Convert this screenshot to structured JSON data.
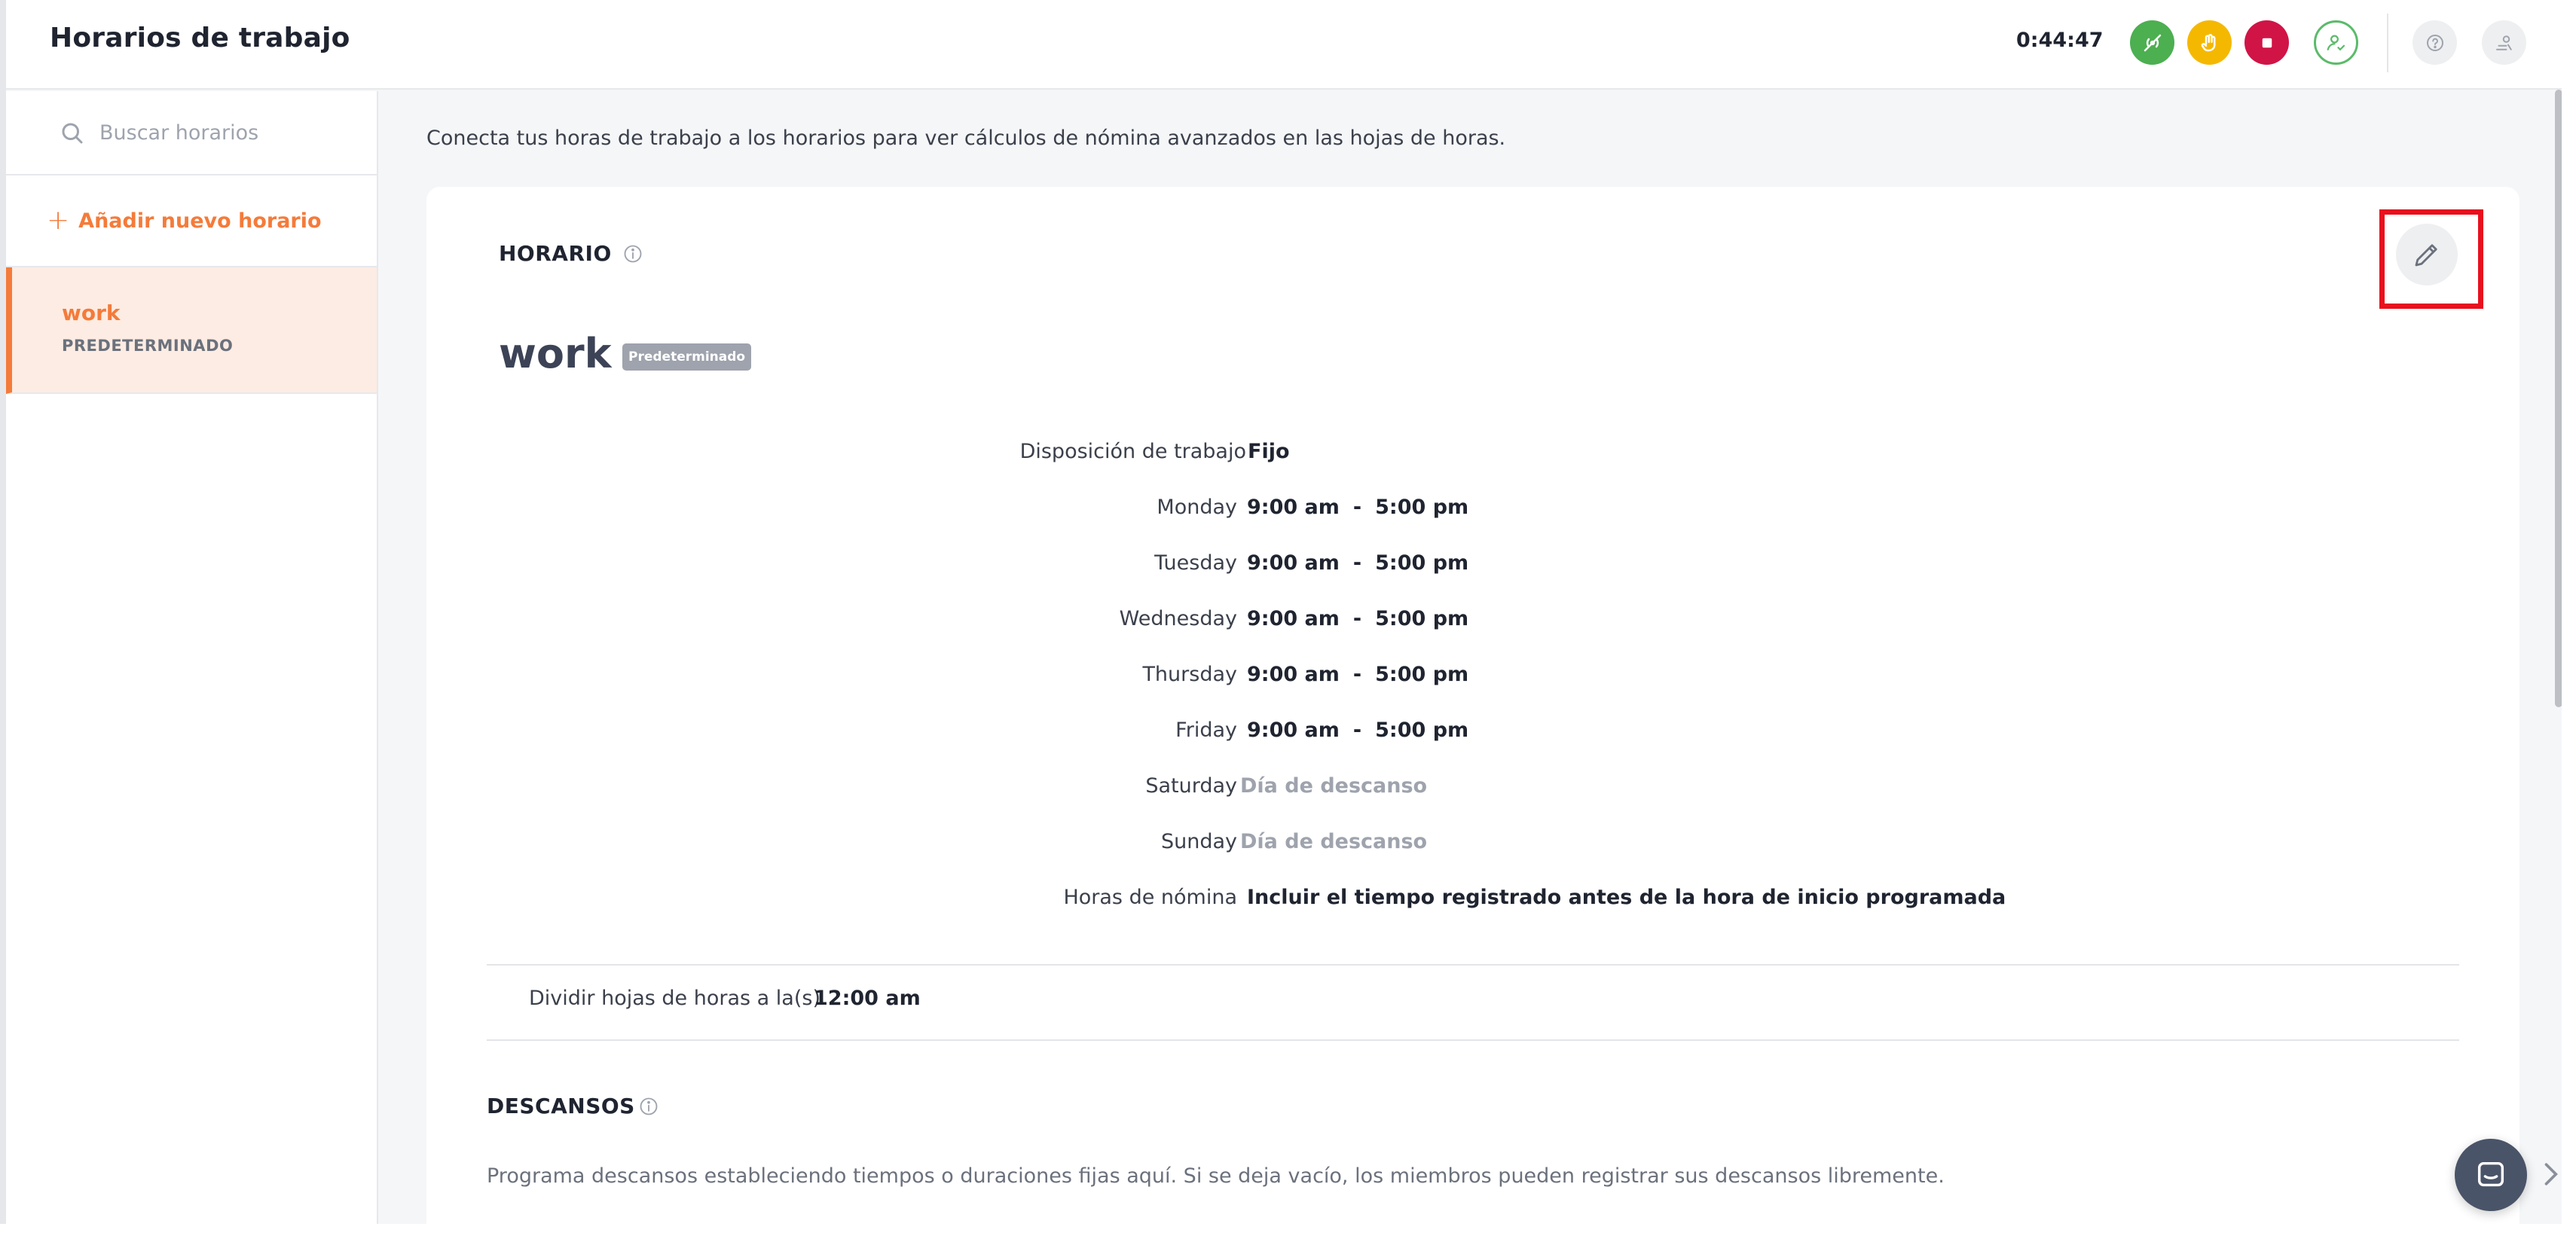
{
  "header": {
    "title": "Horarios de trabajo",
    "timer": "0:44:47"
  },
  "sidebar": {
    "search_placeholder": "Buscar horarios",
    "add_label": "Añadir nuevo horario",
    "schedules": [
      {
        "name": "work",
        "tag": "PREDETERMINADO"
      }
    ]
  },
  "main": {
    "intro": "Conecta tus horas de trabajo a los horarios para ver cálculos de nómina avanzados en las hojas de horas.",
    "schedule_section_title": "HORARIO",
    "schedule_name": "work",
    "default_badge": "Predeterminado",
    "arrangement": {
      "label": "Disposición de trabajo",
      "value": "Fijo"
    },
    "days": [
      {
        "label": "Monday",
        "start": "9:00 am",
        "sep": "-",
        "end": "5:00 pm"
      },
      {
        "label": "Tuesday",
        "start": "9:00 am",
        "sep": "-",
        "end": "5:00 pm"
      },
      {
        "label": "Wednesday",
        "start": "9:00 am",
        "sep": "-",
        "end": "5:00 pm"
      },
      {
        "label": "Thursday",
        "start": "9:00 am",
        "sep": "-",
        "end": "5:00 pm"
      },
      {
        "label": "Friday",
        "start": "9:00 am",
        "sep": "-",
        "end": "5:00 pm"
      },
      {
        "label": "Saturday",
        "off": "Día de descanso"
      },
      {
        "label": "Sunday",
        "off": "Día de descanso"
      }
    ],
    "payroll": {
      "label": "Horas de nómina",
      "value": "Incluir el tiempo registrado antes de la hora de inicio programada"
    },
    "split": {
      "label": "Dividir hojas de horas a la(s)",
      "value": "12:00 am"
    },
    "breaks_title": "DESCANSOS",
    "breaks_desc": "Programa descansos estableciendo tiempos o duraciones fijas aquí. Si se deja vacío, los miembros pueden registrar sus descansos libremente."
  },
  "colors": {
    "accent": "#f47b3a",
    "highlight": "#e8101e",
    "green": "#4caf50",
    "yellow": "#f5b800",
    "red": "#d01446"
  },
  "icons": {
    "header_buttons": [
      "signal-off-icon",
      "hand-icon",
      "stop-icon",
      "user-check-icon",
      "help-icon",
      "settings-icon"
    ],
    "main": [
      "info-icon",
      "pencil-icon",
      "chat-icon",
      "chevron-right-icon",
      "search-icon",
      "plus-icon"
    ]
  }
}
